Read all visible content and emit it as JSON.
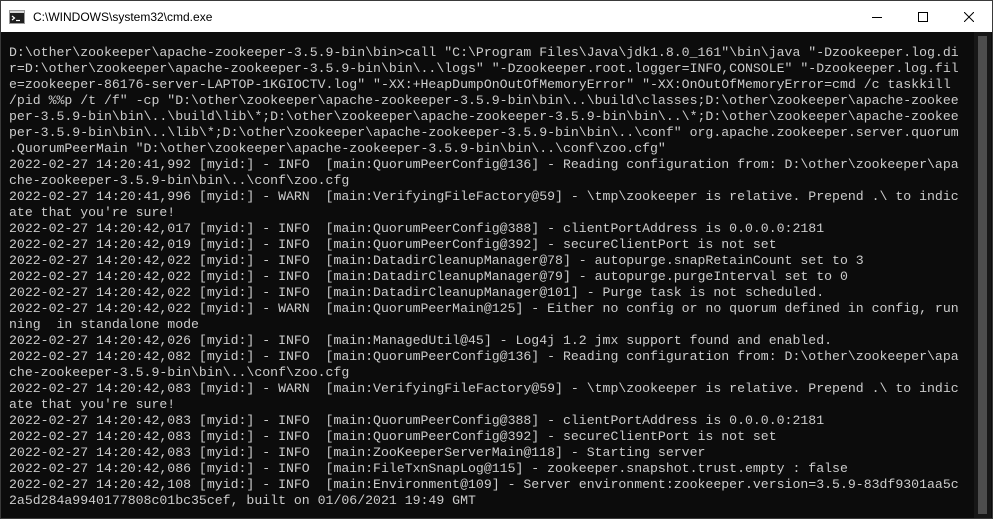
{
  "window": {
    "title": "C:\\WINDOWS\\system32\\cmd.exe"
  },
  "icons": {
    "app": "cmd-console-icon",
    "minimize": "minimize-icon",
    "maximize": "maximize-icon",
    "close": "close-icon"
  },
  "colors": {
    "console_background": "#0c0c0c",
    "console_text": "#cccccc",
    "titlebar_background": "#ffffff"
  },
  "console": {
    "lines": [
      "D:\\other\\zookeeper\\apache-zookeeper-3.5.9-bin\\bin>call \"C:\\Program Files\\Java\\jdk1.8.0_161\"\\bin\\java \"-Dzookeeper.log.di",
      "r=D:\\other\\zookeeper\\apache-zookeeper-3.5.9-bin\\bin\\..\\logs\" \"-Dzookeeper.root.logger=INFO,CONSOLE\" \"-Dzookeeper.log.fil",
      "e=zookeeper-86176-server-LAPTOP-1KGIOCTV.log\" \"-XX:+HeapDumpOnOutOfMemoryError\" \"-XX:OnOutOfMemoryError=cmd /c taskkill",
      "/pid %%p /t /f\" -cp \"D:\\other\\zookeeper\\apache-zookeeper-3.5.9-bin\\bin\\..\\build\\classes;D:\\other\\zookeeper\\apache-zookee",
      "per-3.5.9-bin\\bin\\..\\build\\lib\\*;D:\\other\\zookeeper\\apache-zookeeper-3.5.9-bin\\bin\\..\\*;D:\\other\\zookeeper\\apache-zookee",
      "per-3.5.9-bin\\bin\\..\\lib\\*;D:\\other\\zookeeper\\apache-zookeeper-3.5.9-bin\\bin\\..\\conf\" org.apache.zookeeper.server.quorum",
      ".QuorumPeerMain \"D:\\other\\zookeeper\\apache-zookeeper-3.5.9-bin\\bin\\..\\conf\\zoo.cfg\"",
      "2022-02-27 14:20:41,992 [myid:] - INFO  [main:QuorumPeerConfig@136] - Reading configuration from: D:\\other\\zookeeper\\apa",
      "che-zookeeper-3.5.9-bin\\bin\\..\\conf\\zoo.cfg",
      "2022-02-27 14:20:41,996 [myid:] - WARN  [main:VerifyingFileFactory@59] - \\tmp\\zookeeper is relative. Prepend .\\ to indic",
      "ate that you're sure!",
      "2022-02-27 14:20:42,017 [myid:] - INFO  [main:QuorumPeerConfig@388] - clientPortAddress is 0.0.0.0:2181",
      "2022-02-27 14:20:42,019 [myid:] - INFO  [main:QuorumPeerConfig@392] - secureClientPort is not set",
      "2022-02-27 14:20:42,022 [myid:] - INFO  [main:DatadirCleanupManager@78] - autopurge.snapRetainCount set to 3",
      "2022-02-27 14:20:42,022 [myid:] - INFO  [main:DatadirCleanupManager@79] - autopurge.purgeInterval set to 0",
      "2022-02-27 14:20:42,022 [myid:] - INFO  [main:DatadirCleanupManager@101] - Purge task is not scheduled.",
      "2022-02-27 14:20:42,022 [myid:] - WARN  [main:QuorumPeerMain@125] - Either no config or no quorum defined in config, run",
      "ning  in standalone mode",
      "2022-02-27 14:20:42,026 [myid:] - INFO  [main:ManagedUtil@45] - Log4j 1.2 jmx support found and enabled.",
      "2022-02-27 14:20:42,082 [myid:] - INFO  [main:QuorumPeerConfig@136] - Reading configuration from: D:\\other\\zookeeper\\apa",
      "che-zookeeper-3.5.9-bin\\bin\\..\\conf\\zoo.cfg",
      "2022-02-27 14:20:42,083 [myid:] - WARN  [main:VerifyingFileFactory@59] - \\tmp\\zookeeper is relative. Prepend .\\ to indic",
      "ate that you're sure!",
      "2022-02-27 14:20:42,083 [myid:] - INFO  [main:QuorumPeerConfig@388] - clientPortAddress is 0.0.0.0:2181",
      "2022-02-27 14:20:42,083 [myid:] - INFO  [main:QuorumPeerConfig@392] - secureClientPort is not set",
      "2022-02-27 14:20:42,083 [myid:] - INFO  [main:ZooKeeperServerMain@118] - Starting server",
      "2022-02-27 14:20:42,086 [myid:] - INFO  [main:FileTxnSnapLog@115] - zookeeper.snapshot.trust.empty : false",
      "2022-02-27 14:20:42,108 [myid:] - INFO  [main:Environment@109] - Server environment:zookeeper.version=3.5.9-83df9301aa5c",
      "2a5d284a9940177808c01bc35cef, built on 01/06/2021 19:49 GMT"
    ]
  }
}
